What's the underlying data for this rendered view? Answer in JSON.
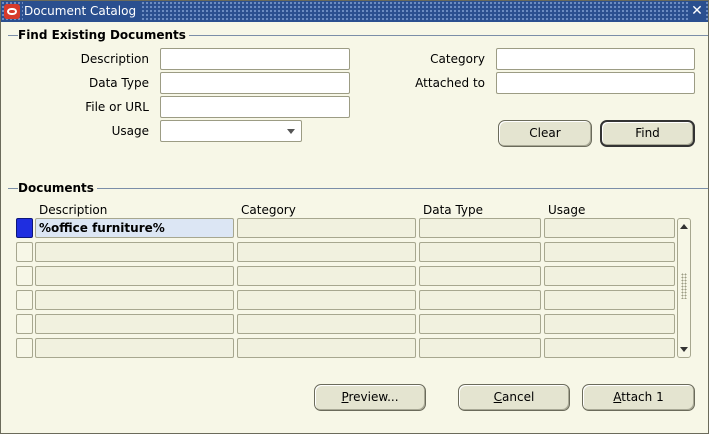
{
  "window": {
    "title": "Document Catalog",
    "close_symbol": "✕",
    "logo_icon": "oracle-logo-icon"
  },
  "find": {
    "section_title": "Find Existing Documents",
    "labels": {
      "description": "Description",
      "data_type": "Data Type",
      "file_or_url": "File or URL",
      "usage": "Usage",
      "category": "Category",
      "attached_to": "Attached to"
    },
    "values": {
      "description": "",
      "data_type": "",
      "file_or_url": "",
      "usage": "",
      "category": "",
      "attached_to": ""
    },
    "clear_label": "Clear",
    "find_label": "Find"
  },
  "documents": {
    "section_title": "Documents",
    "columns": [
      "Description",
      "Category",
      "Data Type",
      "Usage"
    ],
    "rows": [
      [
        "%office furniture%",
        "",
        "",
        ""
      ],
      [
        "",
        "",
        "",
        ""
      ],
      [
        "",
        "",
        "",
        ""
      ],
      [
        "",
        "",
        "",
        ""
      ],
      [
        "",
        "",
        "",
        ""
      ],
      [
        "",
        "",
        "",
        ""
      ]
    ]
  },
  "actions": {
    "preview_label": "Preview...",
    "preview_mnemonic": "P",
    "cancel_label": "Cancel",
    "cancel_mnemonic": "C",
    "attach_label": "Attach 1",
    "attach_mnemonic": "A"
  },
  "colors": {
    "titlebar": "#2a4f8f",
    "window_bg": "#f7f7e7",
    "selected_indicator": "#1f2ee0",
    "current_cell": "#dce6f4"
  }
}
